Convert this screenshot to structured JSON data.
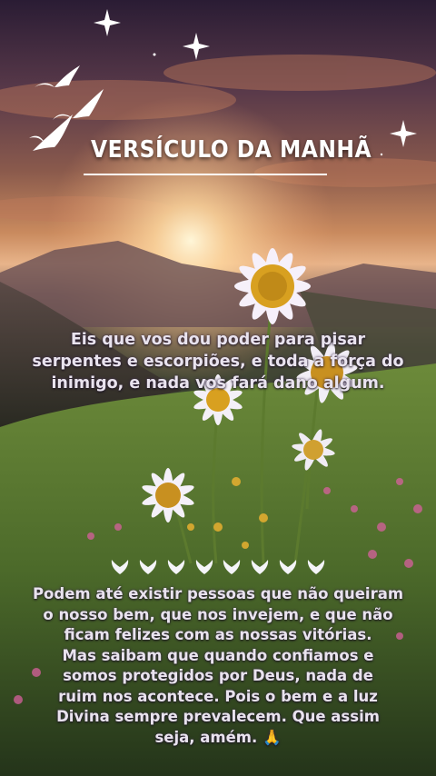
{
  "title": "VERSÍCULO DA MANHÃ",
  "verse_lines": [
    "Eis que vos dou poder para pisar",
    "serpentes e escorpiões, e toda a força do",
    "inimigo, e nada vos fará dano algum."
  ],
  "message_lines": [
    "Podem até existir pessoas que não queiram",
    "o nosso bem, que nos invejem, e que não",
    "ficam felizes com as nossas vitórias.",
    "Mas saibam que quando confiamos e",
    "somos protegidos por Deus, nada de",
    "ruim nos acontece. Pois o bem e a luz",
    "Divina sempre prevalecem. Que assim",
    "seja, amém. 🙏"
  ],
  "icons": [
    "bird-flock-icon",
    "sparkle-star-icon",
    "dove-icon",
    "praying-hands-icon"
  ],
  "colors": {
    "text": "#e9e3ee",
    "title": "#ffffff",
    "sky_top": "#2a1c34",
    "sunset": "#e8b48a",
    "meadow": "#4c6a30"
  }
}
